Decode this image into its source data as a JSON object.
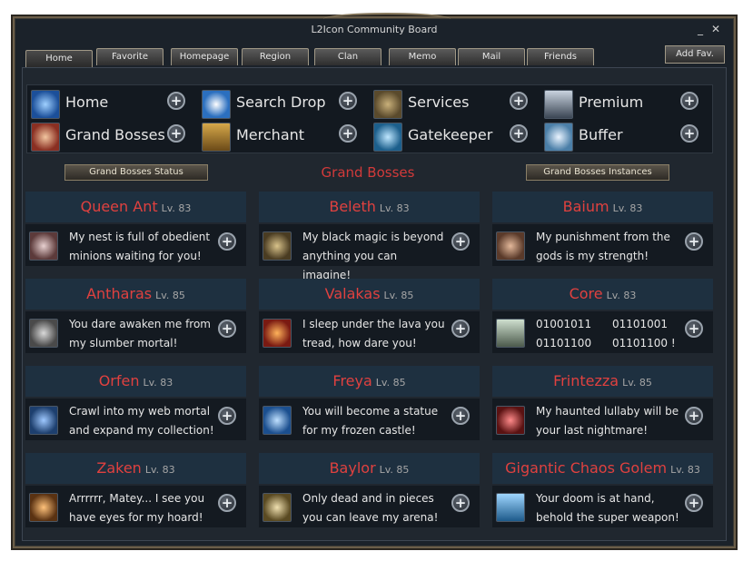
{
  "window": {
    "title": "L2Icon Community Board",
    "minimize_glyph": "_",
    "close_glyph": "✕"
  },
  "tabs": [
    {
      "label": "Home",
      "active": true
    },
    {
      "label": "Favorite"
    },
    {
      "label": "Homepage"
    },
    {
      "label": "Region"
    },
    {
      "label": "Clan"
    },
    {
      "label": "Memo"
    },
    {
      "label": "Mail"
    },
    {
      "label": "Friends"
    }
  ],
  "add_fav_label": "Add Fav.",
  "shortcuts": [
    {
      "label": "Home",
      "icon": "home-icon"
    },
    {
      "label": "Search Drop",
      "icon": "search-drop-icon"
    },
    {
      "label": "Services",
      "icon": "services-icon"
    },
    {
      "label": "Premium",
      "icon": "premium-icon"
    },
    {
      "label": "Grand Bosses",
      "icon": "grand-bosses-icon"
    },
    {
      "label": "Merchant",
      "icon": "merchant-icon"
    },
    {
      "label": "Gatekeeper",
      "icon": "gatekeeper-icon"
    },
    {
      "label": "Buffer",
      "icon": "buffer-icon"
    }
  ],
  "plus_glyph": "+",
  "status_button_label": "Grand Bosses Status",
  "section_title": "Grand Bosses",
  "instances_button_label": "Grand Bosses Instances",
  "bosses": [
    {
      "name": "Queen Ant",
      "level": "Lv. 83",
      "quote": "My nest is full of obedient minions waiting for you!",
      "icon": "queen-ant-icon"
    },
    {
      "name": "Beleth",
      "level": "Lv. 83",
      "quote": "My black magic is beyond anything you can imagine!",
      "icon": "beleth-icon"
    },
    {
      "name": "Baium",
      "level": "Lv. 83",
      "quote": "My punishment from the gods is my strength!",
      "icon": "baium-icon"
    },
    {
      "name": "Antharas",
      "level": "Lv. 85",
      "quote": "You dare awaken me from my slumber mortal!",
      "icon": "antharas-icon"
    },
    {
      "name": "Valakas",
      "level": "Lv. 85",
      "quote": "I sleep under the lava you tread, how dare you!",
      "icon": "valakas-icon"
    },
    {
      "name": "Core",
      "level": "Lv. 83",
      "quote": "01001011      01101001 01101100      01101100 !",
      "icon": "core-icon"
    },
    {
      "name": "Orfen",
      "level": "Lv. 83",
      "quote": "Crawl into my web mortal and expand my collection!",
      "icon": "orfen-icon"
    },
    {
      "name": "Freya",
      "level": "Lv. 85",
      "quote": "You will become a statue for my frozen castle!",
      "icon": "freya-icon"
    },
    {
      "name": "Frintezza",
      "level": "Lv. 85",
      "quote": "My haunted lullaby will be your last nightmare!",
      "icon": "frintezza-icon"
    },
    {
      "name": "Zaken",
      "level": "Lv. 83",
      "quote": "Arrrrrr, Matey... I see you have eyes for my hoard!",
      "icon": "zaken-icon"
    },
    {
      "name": "Baylor",
      "level": "Lv. 85",
      "quote": "Only dead and in pieces you can leave my arena!",
      "icon": "baylor-icon"
    },
    {
      "name": "Gigantic Chaos Golem",
      "level": "Lv. 83",
      "quote": "Your doom is at hand, behold the super weapon!",
      "icon": "chaos-golem-icon"
    }
  ],
  "colors": {
    "boss_name": "#e0413f",
    "section_title": "#d23a3a",
    "panel_bg": "#20272f"
  }
}
